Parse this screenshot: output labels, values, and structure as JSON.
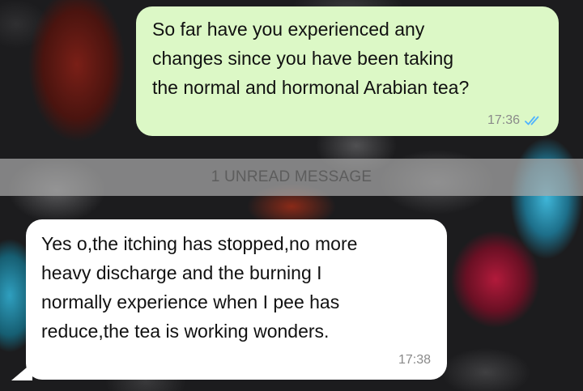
{
  "divider": {
    "label": "1 UNREAD MESSAGE"
  },
  "messages": {
    "outgoing": {
      "text": "So far have you experienced any\nchanges since you have been taking\nthe normal and hormonal Arabian tea?",
      "time": "17:36",
      "status_icon": "double-check-read-icon",
      "status_color": "#4fb3ff"
    },
    "incoming": {
      "text": "Yes o,the itching has stopped,no more\nheavy discharge and the burning I\nnormally experience when I pee has\nreduce,the tea is working wonders.",
      "time": "17:38"
    }
  },
  "colors": {
    "outgoing_bubble": "#dcf8c6",
    "incoming_bubble": "#ffffff",
    "divider_bar": "#aaaaaa"
  }
}
